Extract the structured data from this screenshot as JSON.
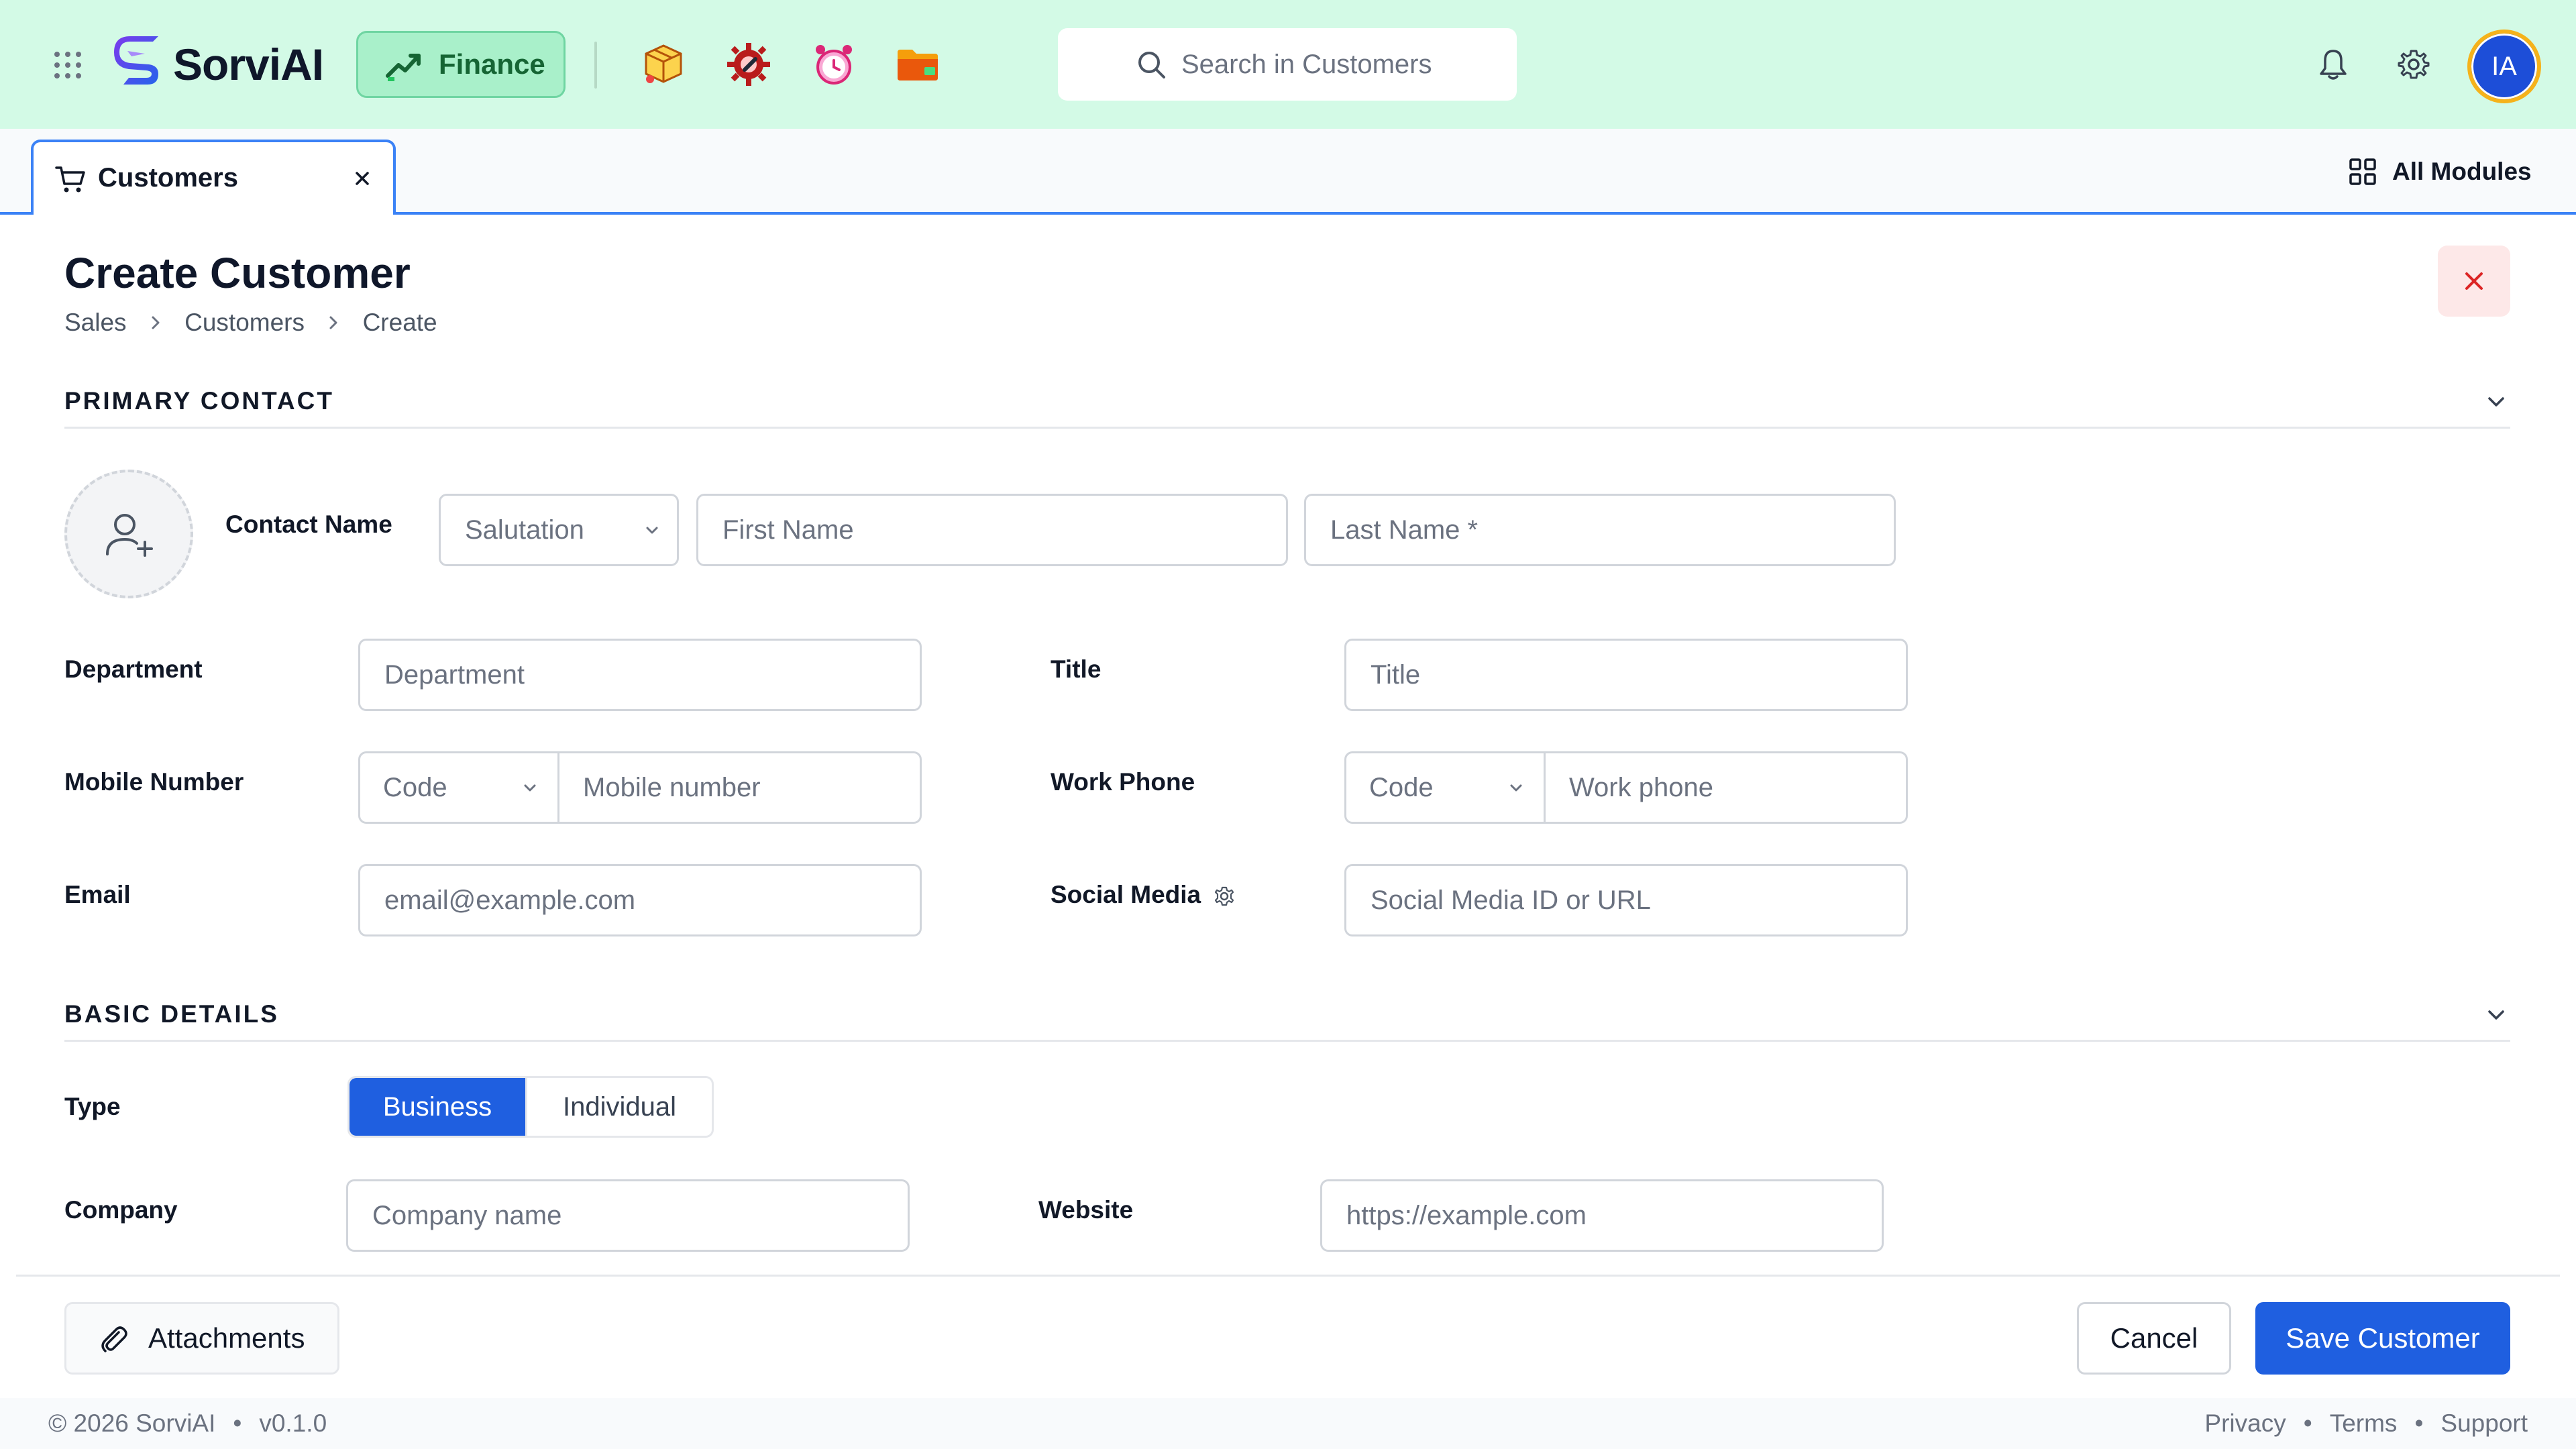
{
  "app": {
    "brand": "SorviAI",
    "module": "Finance",
    "colors": {
      "topbar": "#d3fae6",
      "accent": "#1f5fe0",
      "tab_border": "#3b82f6",
      "avatar_ring": "#f5b21b"
    },
    "launcher_icons": [
      "package-app-icon",
      "gear-wrench-app-icon",
      "alarm-clock-app-icon",
      "folder-app-icon"
    ]
  },
  "search": {
    "placeholder": "Search in Customers"
  },
  "user": {
    "initials": "IA"
  },
  "tabs": [
    {
      "label": "Customers",
      "icon": "cart-icon"
    }
  ],
  "all_modules_label": "All Modules",
  "page": {
    "title": "Create Customer",
    "breadcrumb": [
      "Sales",
      "Customers",
      "Create"
    ]
  },
  "primary_contact": {
    "section_title": "PRIMARY CONTACT",
    "contact_name_label": "Contact Name",
    "salutation_placeholder": "Salutation",
    "first_name_placeholder": "First Name",
    "last_name_placeholder": "Last Name *",
    "department_label": "Department",
    "department_placeholder": "Department",
    "title_label": "Title",
    "title_placeholder": "Title",
    "mobile_label": "Mobile Number",
    "mobile_code_placeholder": "Code",
    "mobile_placeholder": "Mobile number",
    "work_phone_label": "Work Phone",
    "work_code_placeholder": "Code",
    "work_phone_placeholder": "Work phone",
    "email_label": "Email",
    "email_placeholder": "email@example.com",
    "social_label": "Social Media",
    "social_placeholder": "Social Media ID or URL"
  },
  "basic_details": {
    "section_title": "BASIC DETAILS",
    "type_label": "Type",
    "type_options": [
      "Business",
      "Individual"
    ],
    "type_selected": "Business",
    "company_label": "Company",
    "company_placeholder": "Company name",
    "website_label": "Website",
    "website_placeholder": "https://example.com"
  },
  "actions": {
    "attachments": "Attachments",
    "cancel": "Cancel",
    "save": "Save Customer"
  },
  "footer": {
    "copyright": "© 2026 SorviAI",
    "version": "v0.1.0",
    "links": [
      "Privacy",
      "Terms",
      "Support"
    ]
  }
}
